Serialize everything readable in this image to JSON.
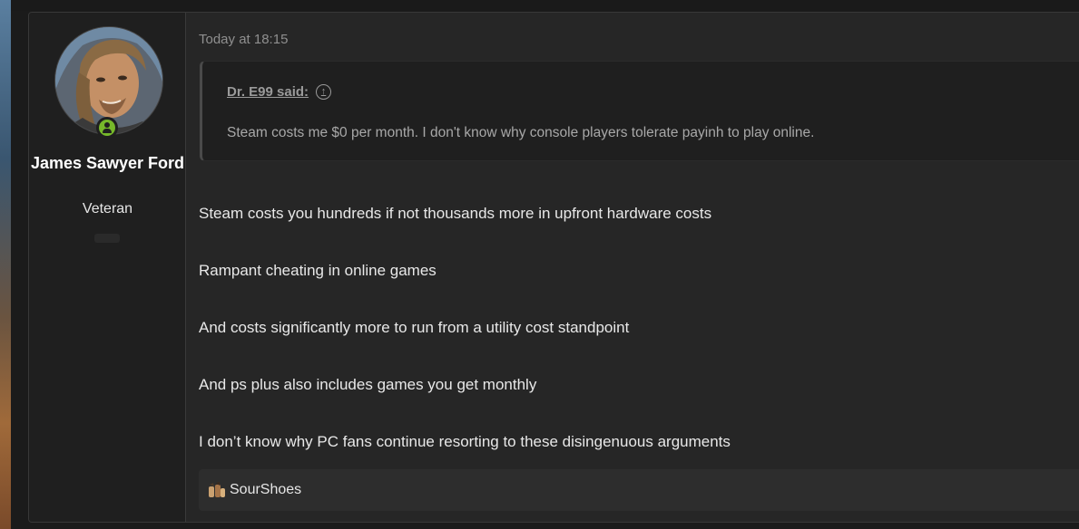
{
  "post": {
    "date": "Today at 18:15",
    "author": {
      "name": "James Sawyer Ford",
      "title": "Veteran",
      "status": "online",
      "avatar_icon": "user-avatar-photo"
    },
    "quote": {
      "author_label": "Dr. E99 said:",
      "jump_icon": "arrow-up-circle-icon",
      "text": "Steam costs me $0 per month. I don't know why console players tolerate payinh to play online."
    },
    "paragraphs": [
      "Steam costs you hundreds if not thousands more in upfront hardware costs",
      "Rampant cheating in online games",
      "And costs significantly more to run from a utility cost standpoint",
      "And ps plus also includes games you get monthly",
      "I don’t know why PC fans continue resorting to these disingenuous arguments"
    ],
    "reactions": {
      "icon": "hands-reaction-icon",
      "users": "SourShoes"
    }
  },
  "colors": {
    "online": "#76b82a",
    "background": "#262626",
    "sidebar": "#1f1f1f"
  }
}
